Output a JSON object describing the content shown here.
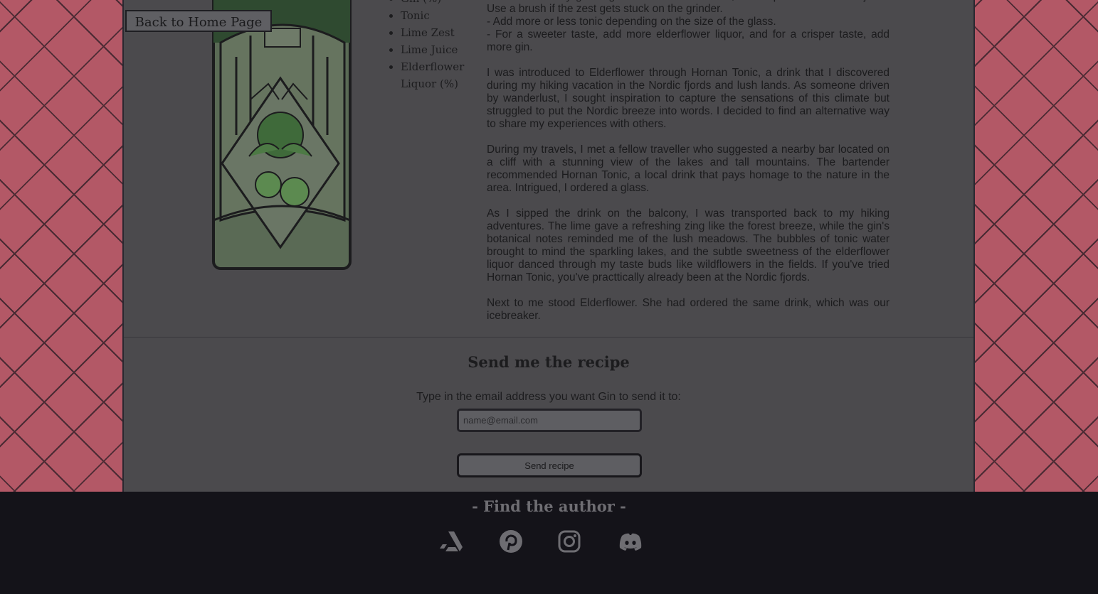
{
  "nav": {
    "back_label": "Back to Home Page"
  },
  "ingredients": [
    "Gin (%)",
    "Tonic",
    "Lime Zest",
    "Lime Juice",
    "Elderflower Liquor (%)"
  ],
  "story": [
    "- Get the zest by grinding the surface of the lime, then squeeze out all the juice. Use a brush if the zest gets stuck on the grinder.\n- Add more or less tonic depending on the size of the glass.\n- For a sweeter taste, add more elderflower liquor, and for a crisper taste, add more gin.",
    "I was introduced to Elderflower through Hornan Tonic, a drink that I discovered during my hiking vacation in the Nordic fjords and lush lands. As someone driven by wanderlust, I sought inspiration to capture the sensations of this climate but struggled to put the Nordic breeze into words. I decided to find an alternative way to share my experiences with others.",
    "During my travels, I met a fellow traveller who suggested a nearby bar located on a cliff with a stunning view of the lakes and tall mountains. The bartender recommended Hornan Tonic, a local drink that pays homage to the nature in the area. Intrigued, I ordered a glass.",
    "As I sipped the drink on the balcony, I was transported back to my hiking adventures. The lime gave a refreshing zing like the forest breeze, while the gin's botanical notes reminded me of the lush meadows. The bubbles of tonic water brought to mind the sparkling lakes, and the subtle sweetness of the elderflower liquor danced through my taste buds like wildflowers in the fields. If you've tried Hornan Tonic, you've practtically already been at the Nordic fjords.",
    "Next to me stood Elderflower. She had ordered the same drink, which was our icebreaker."
  ],
  "recipe_form": {
    "title": "Send me the recipe",
    "label": "Type in the email address you want Gin to send it to:",
    "placeholder": "name@email.com",
    "button_label": "Send recipe"
  },
  "footer": {
    "title": "- Find the author -",
    "socials": [
      "artstation-icon",
      "pinterest-icon",
      "instagram-icon",
      "discord-icon"
    ]
  },
  "colors": {
    "pattern_background": "#b35866",
    "overlay_panel": "#4b4a4d",
    "footer_background": "#141319"
  }
}
